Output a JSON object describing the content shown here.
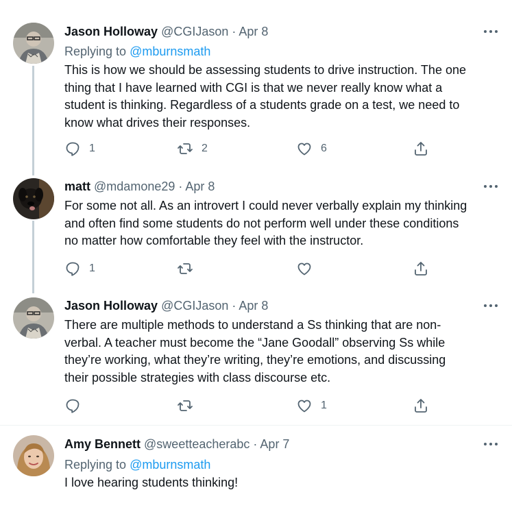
{
  "tweets": [
    {
      "name": "Jason Holloway",
      "handle": "@CGIJason",
      "sep": "·",
      "date": "Apr 8",
      "replying_prefix": "Replying to ",
      "replying_to": "@mburnsmath",
      "lines": [
        "This is how we should be assessing students to drive instruction. The one",
        "thing that I have learned with CGI is that we never really know what a",
        "student is thinking. Regardless of a students grade on a test, we need to",
        "know what drives their responses."
      ],
      "reply_count": "1",
      "retweet_count": "2",
      "like_count": "6"
    },
    {
      "name": "matt",
      "handle": "@mdamone29",
      "sep": "·",
      "date": "Apr 8",
      "lines": [
        "For some not all. As an introvert I could never verbally explain my thinking",
        "and often find some students do not perform well under these conditions",
        "no matter how comfortable they feel with the instructor."
      ],
      "reply_count": "1",
      "retweet_count": "",
      "like_count": ""
    },
    {
      "name": "Jason Holloway",
      "handle": "@CGIJason",
      "sep": "·",
      "date": "Apr 8",
      "lines": [
        "There are multiple methods to understand a Ss thinking that are non-",
        "verbal. A teacher must become the “Jane Goodall” observing Ss while",
        "they’re working, what they’re writing, they’re emotions, and discussing",
        "their possible strategies with class discourse etc."
      ],
      "reply_count": "",
      "retweet_count": "",
      "like_count": "1"
    },
    {
      "name": "Amy Bennett",
      "handle": "@sweetteacherabc",
      "sep": "·",
      "date": "Apr 7",
      "replying_prefix": "Replying to ",
      "replying_to": "@mburnsmath",
      "lines": [
        "I love hearing students thinking!"
      ]
    }
  ],
  "icons": {
    "more": "more-horizontal-icon",
    "reply": "reply-bubble-icon",
    "retweet": "retweet-arrows-icon",
    "like": "heart-icon",
    "share": "share-upload-icon"
  },
  "colors": {
    "text": "#0f1419",
    "muted": "#536471",
    "link": "#1d9bf0",
    "thread_line": "#c4cfd6",
    "divider": "#eff3f4"
  }
}
